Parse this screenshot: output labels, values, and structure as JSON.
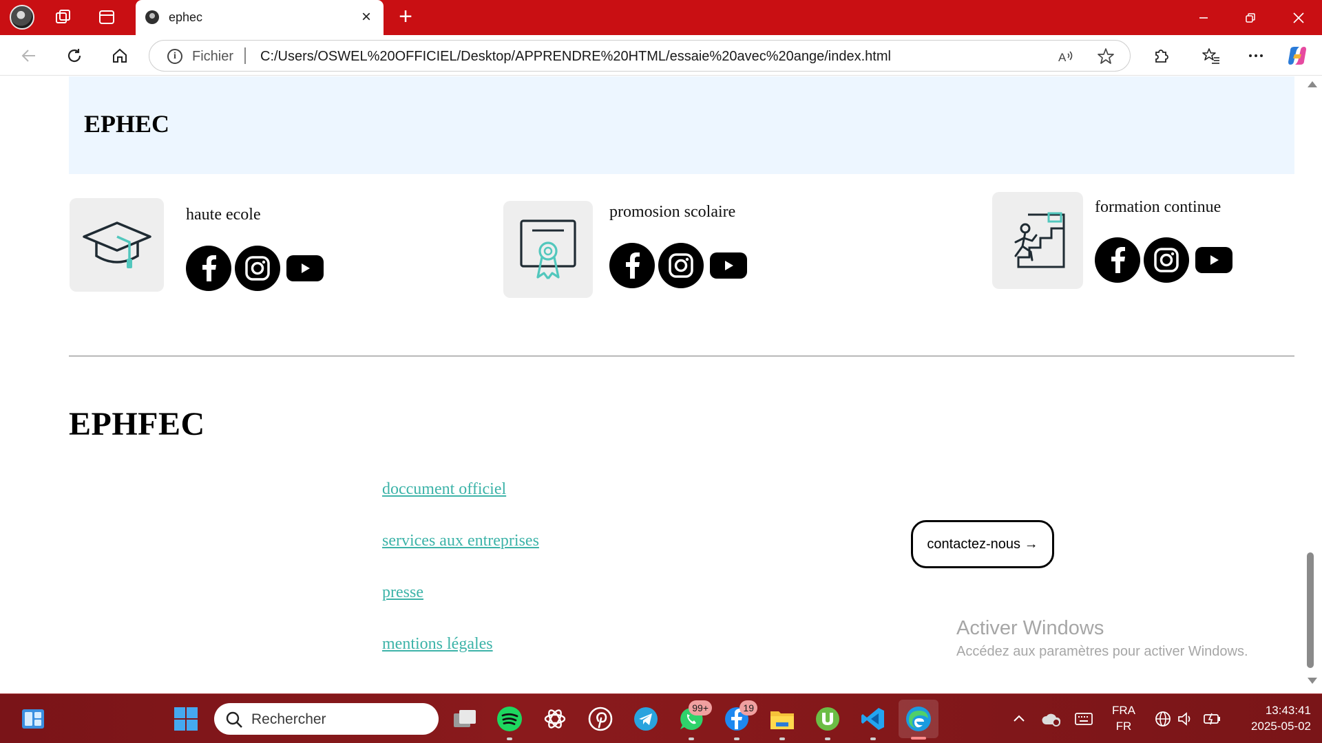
{
  "browser": {
    "tab_title": "ephec",
    "url_scheme_label": "Fichier",
    "url": "C:/Users/OSWEL%20OFFICIEL/Desktop/APPRENDRE%20HTML/essaie%20avec%20ange/index.html"
  },
  "page": {
    "header_title": "EPHEC",
    "cards": [
      {
        "title": "haute ecole",
        "icon": "graduation-cap-icon"
      },
      {
        "title": "promosion scolaire",
        "icon": "certificate-icon"
      },
      {
        "title": "formation continue",
        "icon": "climbing-stairs-icon"
      }
    ],
    "footer_title": "EPHFEC",
    "links": [
      "doccument officiel",
      "services aux entreprises",
      "presse",
      "mentions légales"
    ],
    "contact_button": "contactez-nous →",
    "accent_link_color": "#3cb3a8",
    "header_bg_color": "#edf6ff"
  },
  "watermark": {
    "title": "Activer Windows",
    "subtitle": "Accédez aux paramètres pour activer Windows."
  },
  "taskbar": {
    "search_placeholder": "Rechercher",
    "whatsapp_badge": "99+",
    "messenger_badge": "19",
    "language_top": "FRA",
    "language_bottom": "FR",
    "time": "13:43:41",
    "date": "2025-05-02",
    "bar_color": "#7a1418"
  },
  "chrome_color": "#c90f13"
}
